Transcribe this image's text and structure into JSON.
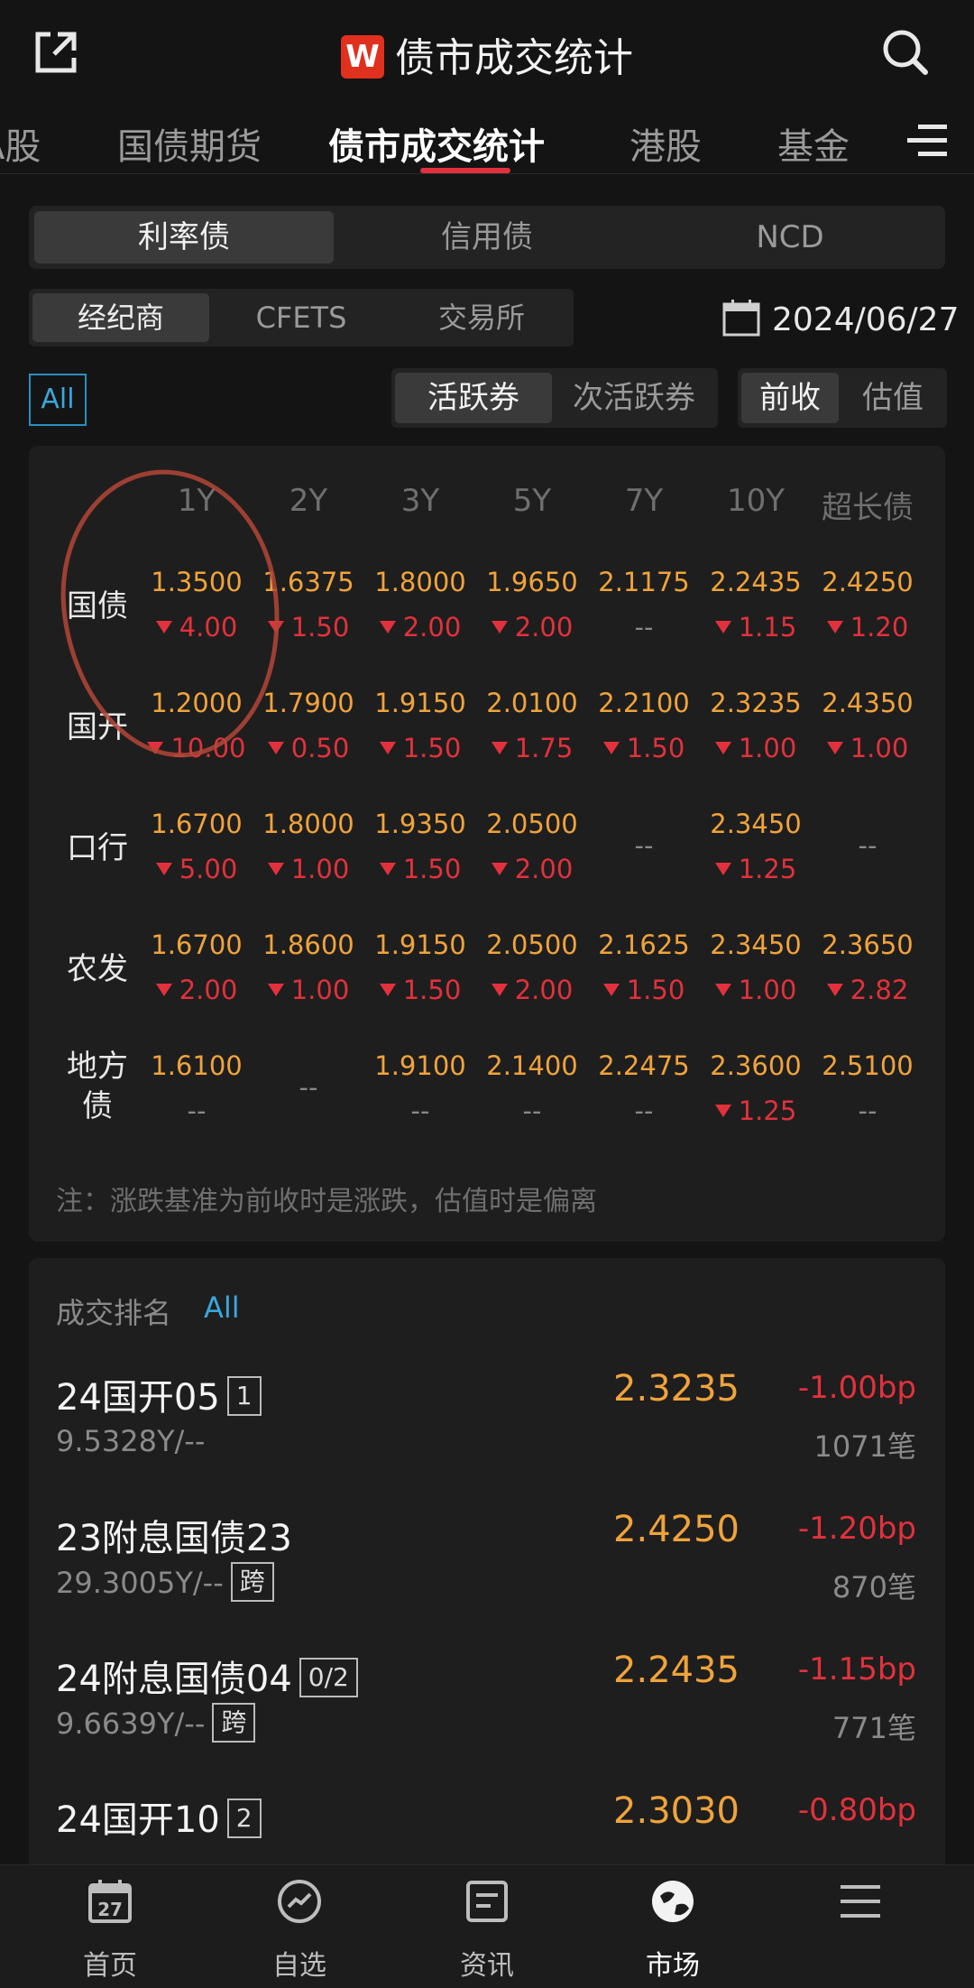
{
  "header": {
    "logo_letter": "W",
    "title": "债市成交统计"
  },
  "tabs": [
    "A股",
    "国债期货",
    "债市成交统计",
    "港股",
    "基金"
  ],
  "bond_type": {
    "options": [
      "利率债",
      "信用债",
      "NCD"
    ],
    "selected": "利率债"
  },
  "source": {
    "options": [
      "经纪商",
      "CFETS",
      "交易所"
    ],
    "selected": "经纪商"
  },
  "date": "2024/06/27",
  "filter_all": "All",
  "activity": {
    "options": [
      "活跃券",
      "次活跃券"
    ],
    "selected": "活跃券"
  },
  "basis": {
    "options": [
      "前收",
      "估值"
    ],
    "selected": "前收"
  },
  "grid": {
    "columns": [
      "1Y",
      "2Y",
      "3Y",
      "5Y",
      "7Y",
      "10Y",
      "超长债"
    ],
    "rows": [
      {
        "label": "国债",
        "values": [
          "1.3500",
          "1.6375",
          "1.8000",
          "1.9650",
          "2.1175",
          "2.2435",
          "2.4250"
        ],
        "changes": [
          "4.00",
          "1.50",
          "2.00",
          "2.00",
          "--",
          "1.15",
          "1.20"
        ]
      },
      {
        "label": "国开",
        "values": [
          "1.2000",
          "1.7900",
          "1.9150",
          "2.0100",
          "2.2100",
          "2.3235",
          "2.4350"
        ],
        "changes": [
          "10.00",
          "0.50",
          "1.50",
          "1.75",
          "1.50",
          "1.00",
          "1.00"
        ]
      },
      {
        "label": "口行",
        "values": [
          "1.6700",
          "1.8000",
          "1.9350",
          "2.0500",
          "",
          "2.3450",
          ""
        ],
        "changes": [
          "5.00",
          "1.00",
          "1.50",
          "2.00",
          "--",
          "1.25",
          "--"
        ]
      },
      {
        "label": "农发",
        "values": [
          "1.6700",
          "1.8600",
          "1.9150",
          "2.0500",
          "2.1625",
          "2.3450",
          "2.3650"
        ],
        "changes": [
          "2.00",
          "1.00",
          "1.50",
          "2.00",
          "1.50",
          "1.00",
          "2.82"
        ]
      },
      {
        "label": "地方\n债",
        "values": [
          "1.6100",
          "",
          "1.9100",
          "2.1400",
          "2.2475",
          "2.3600",
          "2.5100"
        ],
        "changes": [
          "--",
          "--",
          "--",
          "--",
          "--",
          "1.25",
          "--"
        ]
      }
    ],
    "note": "注：涨跌基准为前收时是涨跌，估值时是偏离"
  },
  "ranking": {
    "title": "成交排名",
    "all": "All",
    "items": [
      {
        "name": "24国开05",
        "tag": "1",
        "sub": "9.5328Y/--",
        "sub_tag": "",
        "yield": "2.3235",
        "change": "-1.00bp",
        "count": "1071笔"
      },
      {
        "name": "23附息国债23",
        "tag": "",
        "sub": "29.3005Y/--",
        "sub_tag": "跨",
        "yield": "2.4250",
        "change": "-1.20bp",
        "count": "870笔"
      },
      {
        "name": "24附息国债04",
        "tag": "0/2",
        "sub": "9.6639Y/--",
        "sub_tag": "跨",
        "yield": "2.2435",
        "change": "-1.15bp",
        "count": "771笔"
      },
      {
        "name": "24国开10",
        "tag": "2",
        "sub": "",
        "sub_tag": "",
        "yield": "2.3030",
        "change": "-0.80bp",
        "count": ""
      }
    ]
  },
  "bottom_nav": [
    {
      "label": "首页",
      "icon": "calendar-icon",
      "date_num": "27"
    },
    {
      "label": "自选",
      "icon": "trend-circle-icon"
    },
    {
      "label": "资讯",
      "icon": "news-icon"
    },
    {
      "label": "市场",
      "icon": "globe-icon"
    },
    {
      "label": "",
      "icon": "menu-icon"
    }
  ],
  "colors": {
    "up_down_red": "#e2313c",
    "value_orange": "#f0a33c",
    "accent_blue": "#3aa7dc"
  }
}
